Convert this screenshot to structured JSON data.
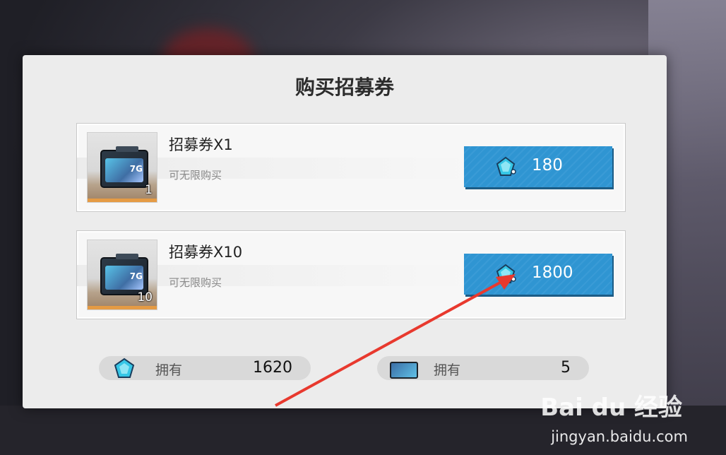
{
  "dialog": {
    "title": "购买招募券",
    "items": [
      {
        "name": "招募券X1",
        "subtitle": "可无限购买",
        "count": "1",
        "price": "180"
      },
      {
        "name": "招募券X10",
        "subtitle": "可无限购买",
        "count": "10",
        "price": "1800"
      }
    ],
    "owned": [
      {
        "icon": "crystal-icon",
        "label": "拥有",
        "value": "1620"
      },
      {
        "icon": "ticket-icon",
        "label": "拥有",
        "value": "5"
      }
    ]
  },
  "watermark": {
    "logo": "Bai du 经验",
    "url": "jingyan.baidu.com"
  },
  "colors": {
    "button": "#2f95d2",
    "dialog_bg": "#ececec",
    "thumb_bar": "#e59b44",
    "arrow": "#e8392e"
  },
  "icons": {
    "currency": "crystal-icon",
    "item": "ticket-icon"
  }
}
